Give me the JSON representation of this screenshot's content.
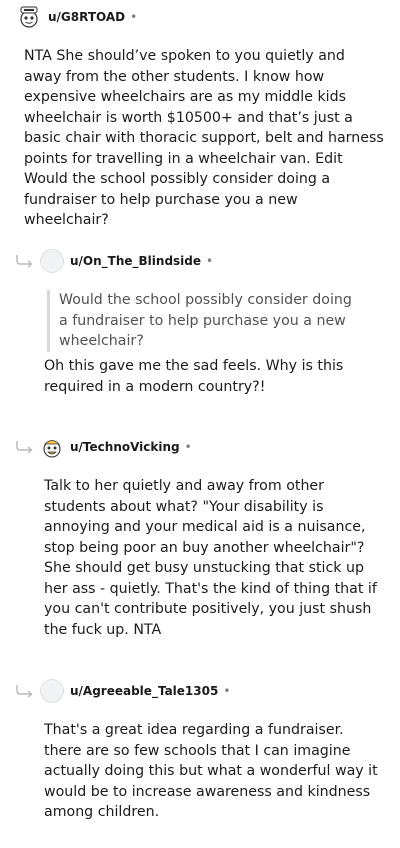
{
  "comments": [
    {
      "username": "u/G8RTOAD",
      "dot": "•",
      "body": "NTA She should’ve spoken to you quietly and away from the other students. I know how expensive wheelchairs are as my middle kids wheelchair is worth $10500+ and that’s just a basic chair with thoracic support, belt and harness points for travelling in a wheelchair van. Edit Would the school possibly consider doing a fundraiser to help purchase you a new wheelchair?"
    },
    {
      "username": "u/On_The_Blindside",
      "dot": "•",
      "quote": "Would the school possibly consider doing a fundraiser to help purchase you a new wheelchair?",
      "body": "Oh this gave me the sad feels. Why is this required in a modern country?!"
    },
    {
      "username": "u/TechnoVicking",
      "dot": "•",
      "body": "Talk to her quietly and away from other students about what? \"Your disability is annoying and your medical aid is a nuisance, stop being poor an buy another wheelchair\"? She should get busy unstucking that stick up her ass - quietly. That's the kind of thing that if you can't contribute positively, you just shush the fuck up. NTA"
    },
    {
      "username": "u/Agreeable_Tale1305",
      "dot": "•",
      "body": "That's a great idea regarding a fundraiser. there are so few schools that I can imagine actually doing this but what a wonderful way it would be to increase awareness and kindness among children."
    }
  ],
  "colors": {
    "text": "#1c1c1c",
    "meta": "#7c7c7c",
    "quote_bar": "#d7d9dc",
    "reply_arrow": "#b5b8bc"
  }
}
